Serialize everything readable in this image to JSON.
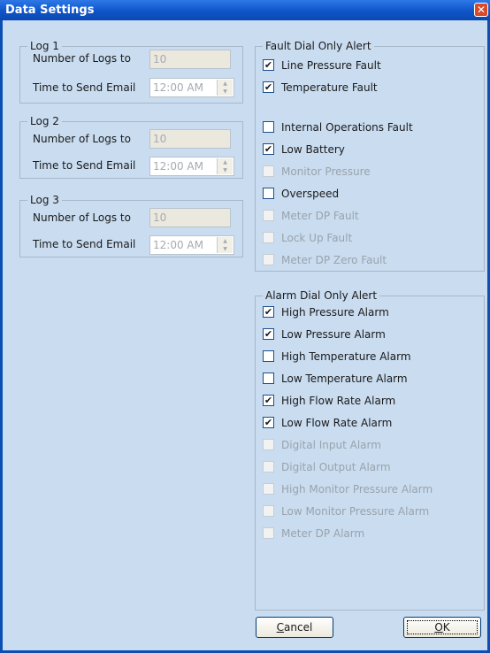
{
  "window": {
    "title": "Data Settings",
    "close_glyph": "✕"
  },
  "logs": [
    {
      "title": "Log 1",
      "count_label": "Number of Logs to",
      "count_value": "10",
      "time_label": "Time to Send Email",
      "time_value": "12:00 AM"
    },
    {
      "title": "Log 2",
      "count_label": "Number of Logs to",
      "count_value": "10",
      "time_label": "Time to Send Email",
      "time_value": "12:00 AM"
    },
    {
      "title": "Log 3",
      "count_label": "Number of Logs to",
      "count_value": "10",
      "time_label": "Time to Send Email",
      "time_value": "12:00 AM"
    }
  ],
  "fault": {
    "title": "Fault Dial Only Alert",
    "items": [
      {
        "label": "Line Pressure Fault",
        "checked": true,
        "enabled": true
      },
      {
        "label": "Temperature Fault",
        "checked": true,
        "enabled": true
      },
      {
        "label": "Internal Operations Fault",
        "checked": false,
        "enabled": true
      },
      {
        "label": "Low Battery",
        "checked": true,
        "enabled": true
      },
      {
        "label": "Monitor Pressure",
        "checked": false,
        "enabled": false
      },
      {
        "label": "Overspeed",
        "checked": false,
        "enabled": true
      },
      {
        "label": "Meter DP Fault",
        "checked": false,
        "enabled": false
      },
      {
        "label": "Lock Up Fault",
        "checked": false,
        "enabled": false
      },
      {
        "label": "Meter DP Zero Fault",
        "checked": false,
        "enabled": false
      }
    ]
  },
  "alarm": {
    "title": "Alarm Dial Only Alert",
    "items": [
      {
        "label": "High Pressure Alarm",
        "checked": true,
        "enabled": true
      },
      {
        "label": "Low Pressure Alarm",
        "checked": true,
        "enabled": true
      },
      {
        "label": "High Temperature Alarm",
        "checked": false,
        "enabled": true
      },
      {
        "label": "Low Temperature Alarm",
        "checked": false,
        "enabled": true
      },
      {
        "label": "High Flow Rate Alarm",
        "checked": true,
        "enabled": true
      },
      {
        "label": "Low Flow Rate Alarm",
        "checked": true,
        "enabled": true
      },
      {
        "label": "Digital Input Alarm",
        "checked": false,
        "enabled": false
      },
      {
        "label": "Digital Output Alarm",
        "checked": false,
        "enabled": false
      },
      {
        "label": "High Monitor Pressure Alarm",
        "checked": false,
        "enabled": false
      },
      {
        "label": "Low Monitor Pressure Alarm",
        "checked": false,
        "enabled": false
      },
      {
        "label": "Meter DP Alarm",
        "checked": false,
        "enabled": false
      }
    ]
  },
  "buttons": {
    "cancel_key": "C",
    "cancel_rest": "ancel",
    "ok_key": "O",
    "ok_rest": "K"
  },
  "check_glyph": "✔"
}
